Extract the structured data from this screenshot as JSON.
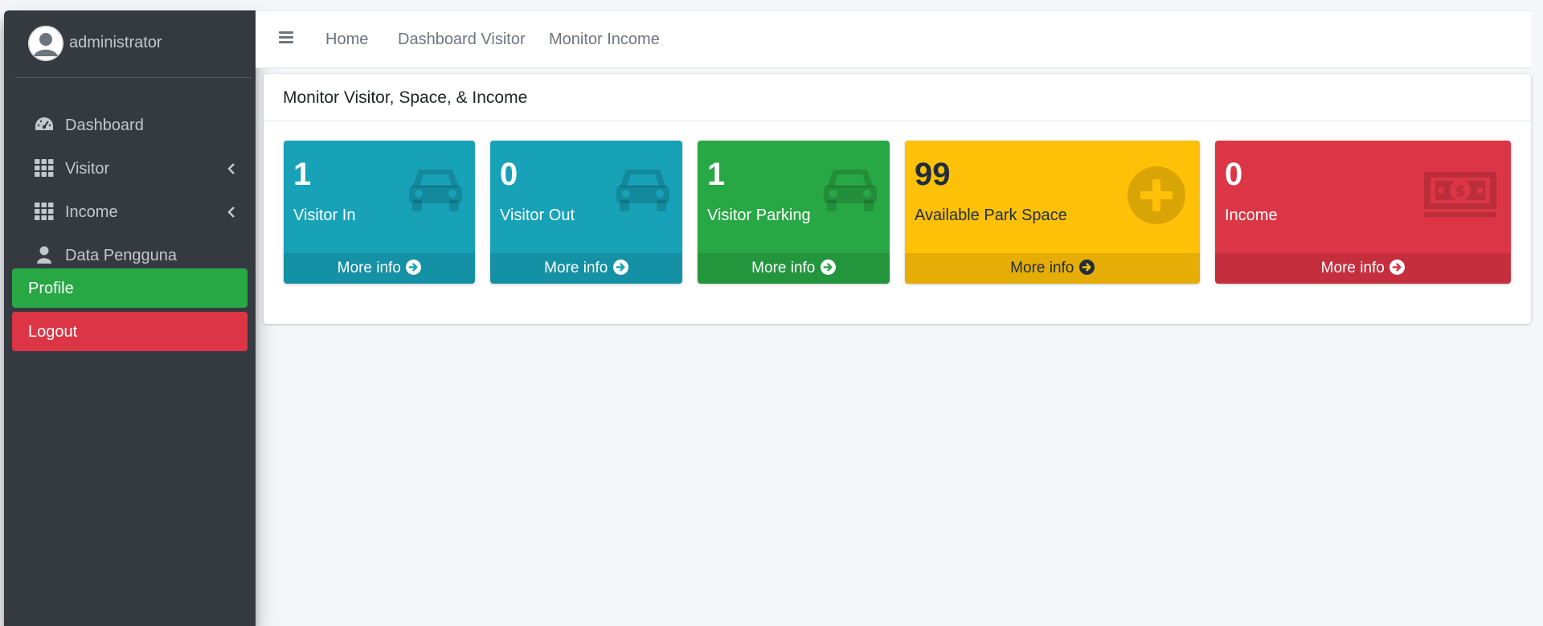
{
  "colors": {
    "sidebar_bg": "#343a40",
    "info": "#17a2b8",
    "success": "#28a745",
    "warning": "#ffc107",
    "danger": "#dc3545",
    "text_light": "#c2c7d0"
  },
  "sidebar": {
    "user_name": "administrator",
    "items": [
      {
        "label": "Dashboard",
        "icon": "tachometer-icon"
      },
      {
        "label": "Visitor",
        "icon": "grid-icon",
        "has_submenu": true
      },
      {
        "label": "Income",
        "icon": "grid-icon",
        "has_submenu": true
      },
      {
        "label": "Data Pengguna",
        "icon": "user-icon"
      }
    ],
    "profile_label": "Profile",
    "logout_label": "Logout"
  },
  "navbar": {
    "links": [
      "Home",
      "Dashboard Visitor",
      "Monitor Income"
    ]
  },
  "card": {
    "title": "Monitor Visitor, Space, & Income"
  },
  "boxes": [
    {
      "value": "1",
      "label": "Visitor In",
      "footer": "More info",
      "icon": "car-icon",
      "color": "#17a2b8"
    },
    {
      "value": "0",
      "label": "Visitor Out",
      "footer": "More info",
      "icon": "car-icon",
      "color": "#17a2b8"
    },
    {
      "value": "1",
      "label": "Visitor Parking",
      "footer": "More info",
      "icon": "car-icon",
      "color": "#28a745"
    },
    {
      "value": "99",
      "label": "Available Park Space",
      "footer": "More info",
      "icon": "plus-circle-icon",
      "color": "#ffc107"
    },
    {
      "value": "0",
      "label": "Income",
      "footer": "More info",
      "icon": "money-bill-icon",
      "color": "#dc3545"
    }
  ]
}
